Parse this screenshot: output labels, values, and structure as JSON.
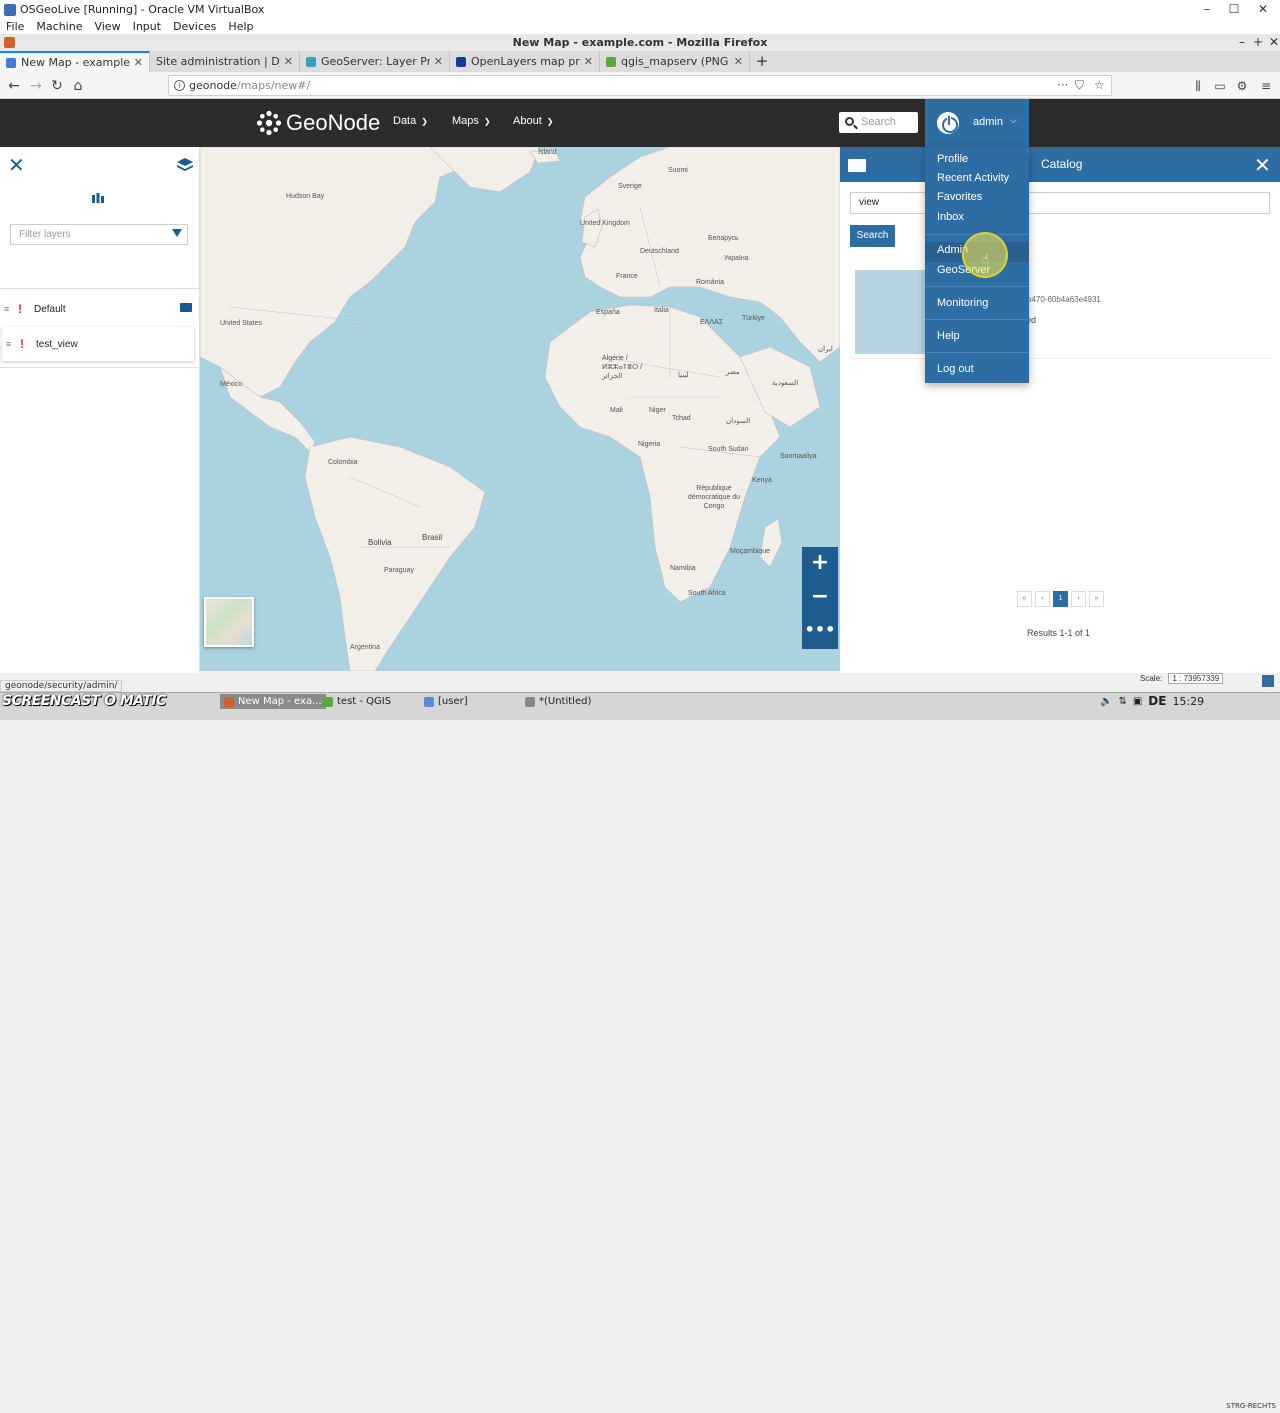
{
  "vbox": {
    "title": "OSGeoLive [Running] - Oracle VM VirtualBox",
    "menu": [
      "File",
      "Machine",
      "View",
      "Input",
      "Devices",
      "Help"
    ],
    "status_right": "STRG-RECHTS"
  },
  "firefox": {
    "window_title": "New Map - example.com - Mozilla Firefox",
    "tabs": [
      {
        "label": "New Map - example.com",
        "favicon_color": "#3b7dd8",
        "active": true
      },
      {
        "label": "Site administration | Django",
        "favicon_color": "",
        "active": false
      },
      {
        "label": "GeoServer: Layer Preview",
        "favicon_color": "#3aa0b8",
        "active": false
      },
      {
        "label": "OpenLayers map preview",
        "favicon_color": "#1a3b8f",
        "active": false
      },
      {
        "label": "qgis_mapserv (PNG Image",
        "favicon_color": "#5aa93a",
        "active": false
      }
    ],
    "url_host": "geonode",
    "url_path": "/maps/new#/",
    "status_url": "geonode/security/admin/"
  },
  "header": {
    "brand": "GeoNode",
    "nav": [
      "Data",
      "Maps",
      "About"
    ],
    "search_placeholder": "Search",
    "username": "admin"
  },
  "user_menu": {
    "items": [
      "Profile",
      "Recent Activity",
      "Favorites",
      "Inbox",
      "Admin",
      "GeoServer",
      "Monitoring",
      "Help",
      "Log out"
    ],
    "hovered": "Admin"
  },
  "layer_panel": {
    "filter_placeholder": "Filter layers",
    "group": "Default",
    "layer": "test_view"
  },
  "map": {
    "labels": [
      "Ísland",
      "Sverige",
      "Suomi",
      "Hudson Bay",
      "United Kingdom",
      "Беларусь",
      "Deutschland",
      "Україна",
      "France",
      "România",
      "España",
      "Italia",
      "ΕΛΛΑΣ",
      "Türkiye",
      "United States",
      "ایران",
      "México",
      "Algérie / ⵍⵣⵣⴰⵢⴻⵔ / الجزائر",
      "ليبيا",
      "مصر",
      "السعودية",
      "Mali",
      "Niger",
      "Tchad",
      "السودان",
      "Nigeria",
      "South Sudan",
      "Soomaaliya",
      "Colombia",
      "Kenya",
      "République démocratique du Congo",
      "Brasil",
      "Bolivia",
      "Paraguay",
      "Moçambique",
      "Namibia",
      "South Africa",
      "Argentina"
    ]
  },
  "catalog": {
    "title": "Catalog",
    "search_value": "view",
    "search_button": "Search",
    "record_id_fragment": "b470-60b4a63e4931",
    "record_status_fragment": "ed",
    "pages": [
      "«",
      "‹",
      "1",
      "›",
      "»"
    ],
    "current_page": "1",
    "results_text": "Results 1-1 of 1"
  },
  "scale": {
    "label": "Scale:",
    "value": "1 : 73957339"
  },
  "taskbar": {
    "watermark": "SCREENCAST O MATIC",
    "items": [
      "New Map - exa...",
      "test - QGIS",
      "[user]",
      "*(Untitled)"
    ],
    "active": "New Map - exa...",
    "keyboard": "DE",
    "time": "15:29"
  }
}
